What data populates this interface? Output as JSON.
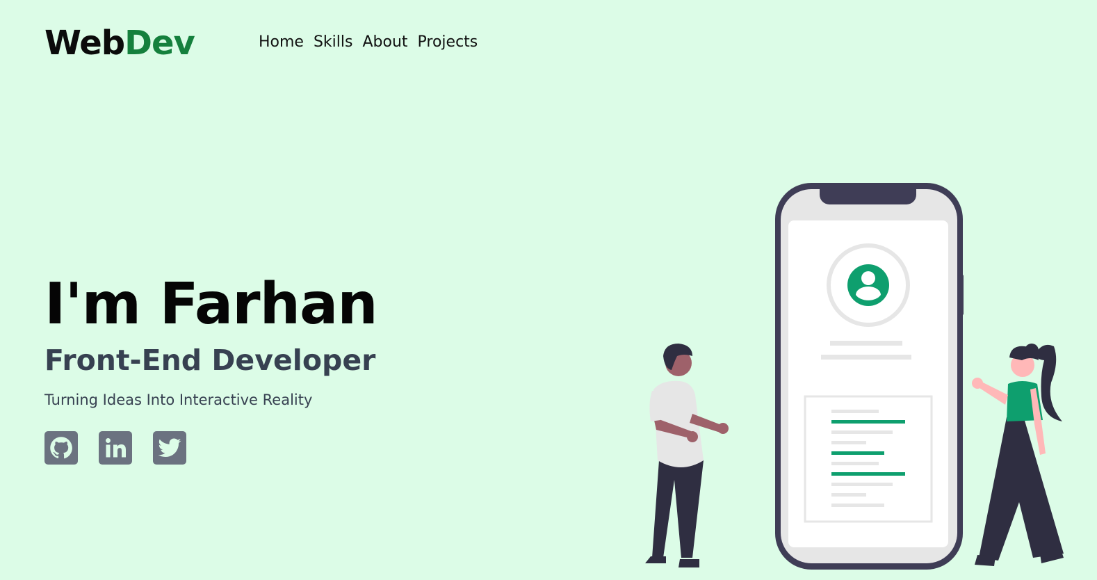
{
  "brand": {
    "primary": "Web",
    "accent": "Dev",
    "accent_color": "#15803d"
  },
  "nav": {
    "items": [
      {
        "label": "Home"
      },
      {
        "label": "Skills"
      },
      {
        "label": "About"
      },
      {
        "label": "Projects"
      }
    ]
  },
  "hero": {
    "title": "I'm Farhan",
    "subtitle": "Front-End Developer",
    "tagline": "Turning Ideas Into Interactive Reality"
  },
  "social": [
    {
      "icon": "github-icon"
    },
    {
      "icon": "linkedin-icon"
    },
    {
      "icon": "twitter-icon"
    }
  ],
  "colors": {
    "background": "#dcfce7",
    "social_bg": "#6b7280",
    "illustration_accent": "#0e9f6e",
    "phone_frame": "#3f3d56"
  }
}
